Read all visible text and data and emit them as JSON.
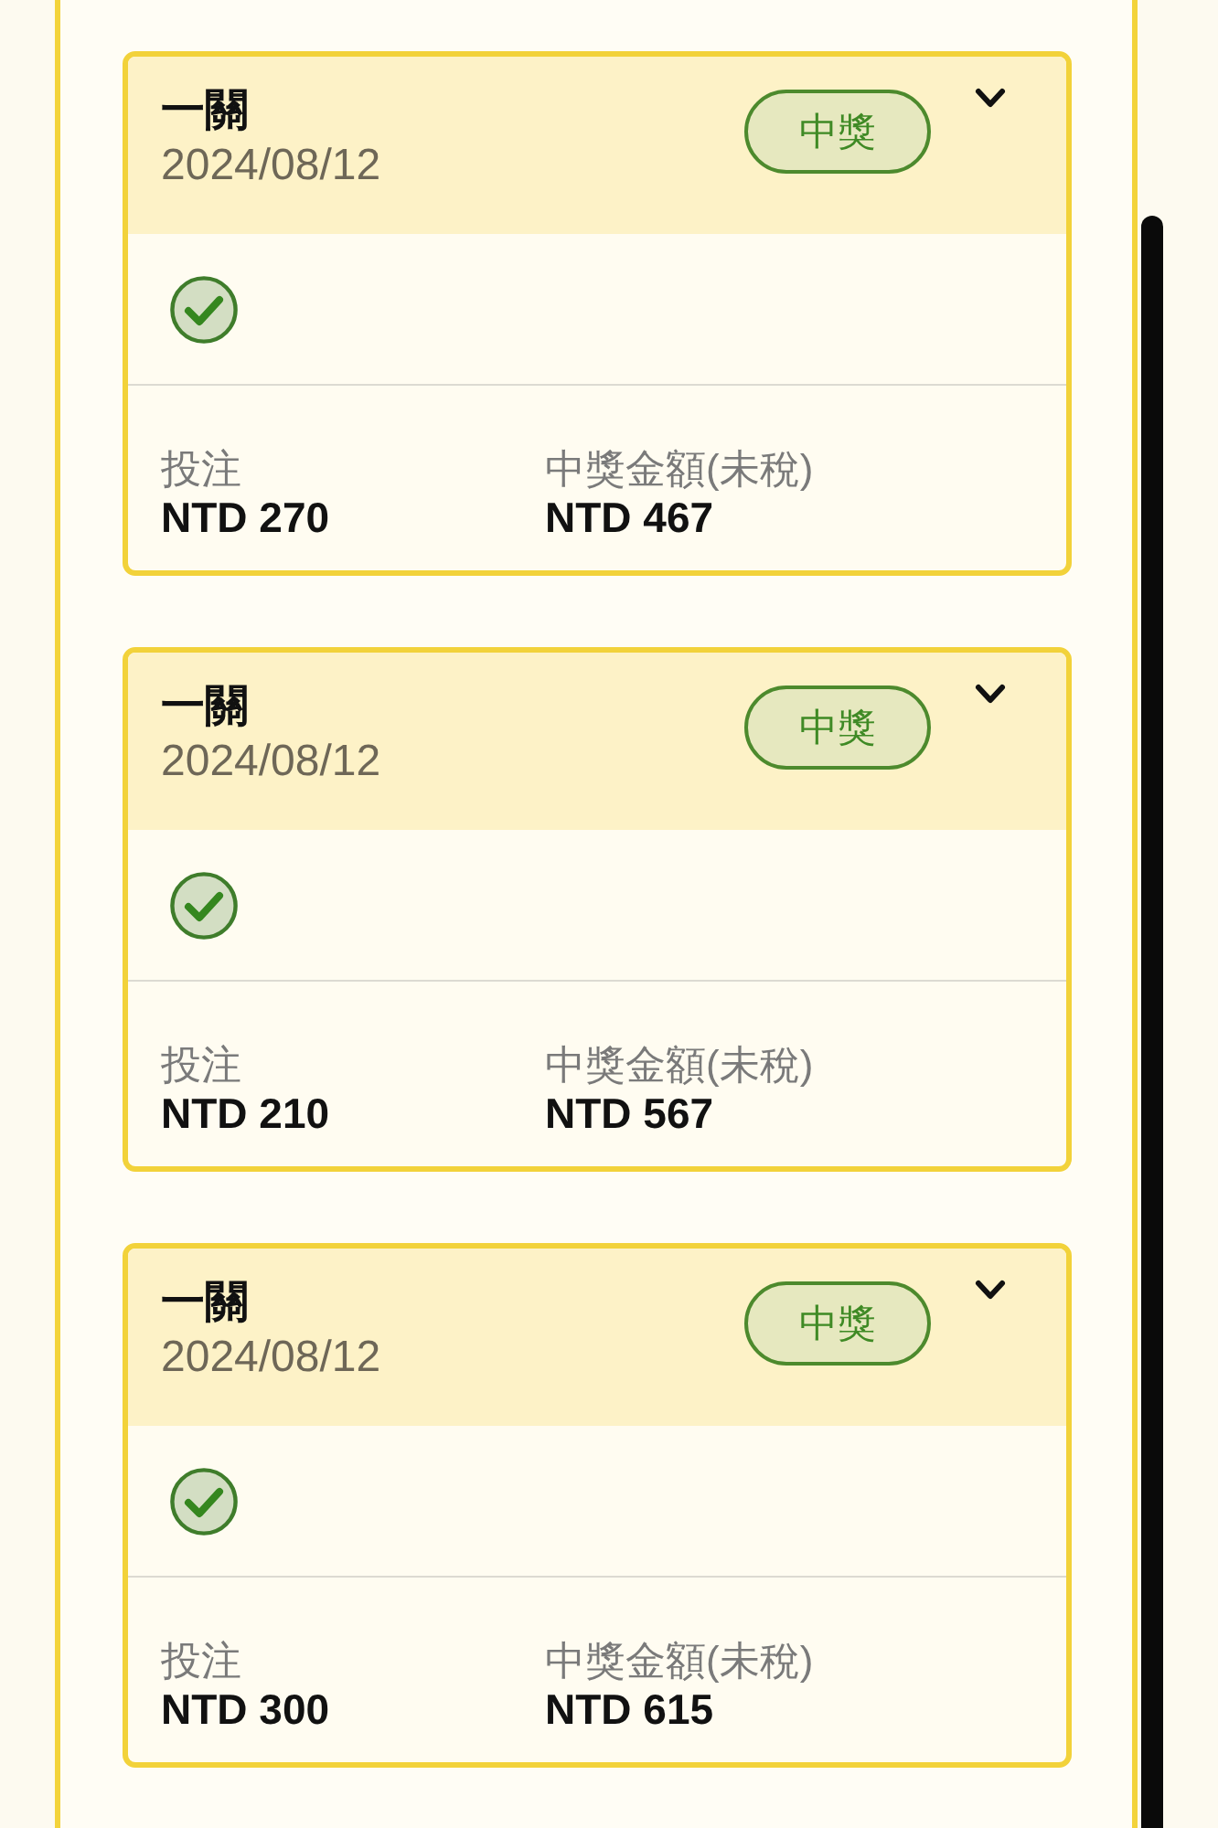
{
  "cards": [
    {
      "title": "一關",
      "date": "2024/08/12",
      "badge": "中獎",
      "bet_label": "投注",
      "bet": "NTD 270",
      "prize_label": "中獎金額(未稅)",
      "prize": "NTD 467"
    },
    {
      "title": "一關",
      "date": "2024/08/12",
      "badge": "中獎",
      "bet_label": "投注",
      "bet": "NTD 210",
      "prize_label": "中獎金額(未稅)",
      "prize": "NTD 567"
    },
    {
      "title": "一關",
      "date": "2024/08/12",
      "badge": "中獎",
      "bet_label": "投注",
      "bet": "NTD 300",
      "prize_label": "中獎金額(未稅)",
      "prize": "NTD 615"
    }
  ]
}
